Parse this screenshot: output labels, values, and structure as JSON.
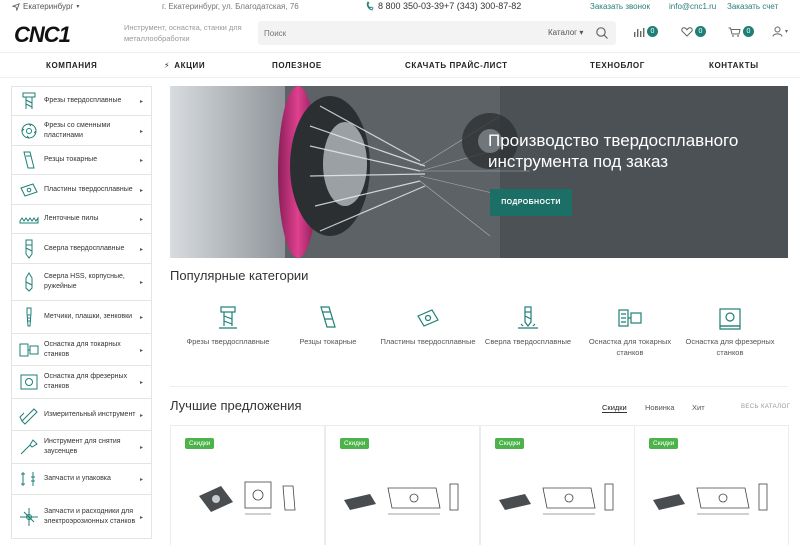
{
  "topbar": {
    "city": "Екатеринбург",
    "address": "г. Екатеринбург, ул. Благодатская, 76",
    "phone1": "8 800 350-03-39",
    "phone2": "+7 (343) 300-87-82",
    "callback": "Заказать звонок",
    "email": "info@cnc1.ru",
    "invoice": "Заказать счет"
  },
  "header": {
    "logo_text": "CNC1",
    "tagline": "Инструмент, оснастка, станки для металлообработки",
    "search_placeholder": "Поиск",
    "catalog_label": "Каталог",
    "compare_count": "0",
    "favorites_count": "0",
    "cart_count": "0"
  },
  "nav": {
    "items": [
      "КОМПАНИЯ",
      "АКЦИИ",
      "ПОЛЕЗНОЕ",
      "СКАЧАТЬ ПРАЙС-ЛИСТ",
      "ТЕХНОБЛОГ",
      "КОНТАКТЫ"
    ]
  },
  "sidebar": {
    "items": [
      {
        "label": "Фрезы твердосплавные",
        "icon": "end-mill-icon"
      },
      {
        "label": "Фрезы со сменными пластинами",
        "icon": "face-mill-icon"
      },
      {
        "label": "Резцы токарные",
        "icon": "lathe-tool-icon"
      },
      {
        "label": "Пластины твердосплавные",
        "icon": "insert-icon"
      },
      {
        "label": "Ленточные пилы",
        "icon": "band-saw-icon"
      },
      {
        "label": "Сверла твердосплавные",
        "icon": "drill-icon"
      },
      {
        "label": "Сверла HSS, корпусные, ружейные",
        "icon": "hss-drill-icon"
      },
      {
        "label": "Метчики, плашки, зенковки",
        "icon": "tap-icon"
      },
      {
        "label": "Оснастка для токарных станков",
        "icon": "lathe-tooling-icon"
      },
      {
        "label": "Оснастка для фрезерных станков",
        "icon": "milling-tooling-icon"
      },
      {
        "label": "Измерительный инструмент",
        "icon": "caliper-icon"
      },
      {
        "label": "Инструмент для снятия заусенцев",
        "icon": "deburr-icon"
      },
      {
        "label": "Запчасти и упаковка",
        "icon": "parts-icon"
      },
      {
        "label": "Запчасти и расходники для электроэрозионных станков",
        "icon": "edm-parts-icon"
      }
    ]
  },
  "banner": {
    "title": "Производство твердосплавного инструмента под заказ",
    "button": "ПОДРОБНОСТИ"
  },
  "popular": {
    "title": "Популярные категории",
    "items": [
      {
        "label": "Фрезы твердосплавные",
        "icon": "end-mill-icon"
      },
      {
        "label": "Резцы токарные",
        "icon": "lathe-tool-icon"
      },
      {
        "label": "Пластины твердосплавные",
        "icon": "insert-icon"
      },
      {
        "label": "Сверла твердосплавные",
        "icon": "drill-icon"
      },
      {
        "label": "Оснастка для токарных станков",
        "icon": "lathe-tooling-icon"
      },
      {
        "label": "Оснастка для фрезерных станков",
        "icon": "milling-tooling-icon"
      }
    ]
  },
  "offers": {
    "title": "Лучшие предложения",
    "tabs": [
      "Скидки",
      "Новинка",
      "Хит"
    ],
    "all_link": "ВЕСЬ КАТАЛОГ",
    "discount_badge": "Скидки"
  },
  "colors": {
    "accent": "#1e7f76",
    "discount": "#4cb34b"
  }
}
